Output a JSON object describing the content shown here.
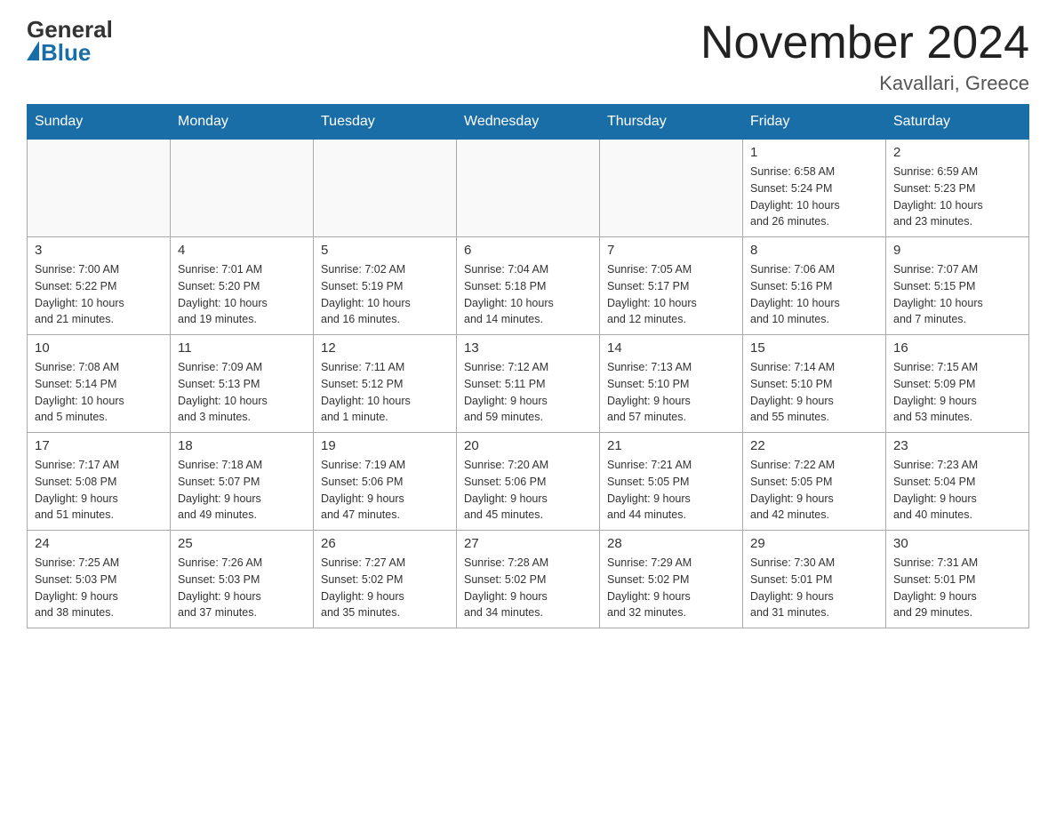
{
  "header": {
    "logo_general": "General",
    "logo_blue": "Blue",
    "month_title": "November 2024",
    "location": "Kavallari, Greece"
  },
  "weekdays": [
    "Sunday",
    "Monday",
    "Tuesday",
    "Wednesday",
    "Thursday",
    "Friday",
    "Saturday"
  ],
  "weeks": [
    [
      {
        "day": "",
        "info": ""
      },
      {
        "day": "",
        "info": ""
      },
      {
        "day": "",
        "info": ""
      },
      {
        "day": "",
        "info": ""
      },
      {
        "day": "",
        "info": ""
      },
      {
        "day": "1",
        "info": "Sunrise: 6:58 AM\nSunset: 5:24 PM\nDaylight: 10 hours\nand 26 minutes."
      },
      {
        "day": "2",
        "info": "Sunrise: 6:59 AM\nSunset: 5:23 PM\nDaylight: 10 hours\nand 23 minutes."
      }
    ],
    [
      {
        "day": "3",
        "info": "Sunrise: 7:00 AM\nSunset: 5:22 PM\nDaylight: 10 hours\nand 21 minutes."
      },
      {
        "day": "4",
        "info": "Sunrise: 7:01 AM\nSunset: 5:20 PM\nDaylight: 10 hours\nand 19 minutes."
      },
      {
        "day": "5",
        "info": "Sunrise: 7:02 AM\nSunset: 5:19 PM\nDaylight: 10 hours\nand 16 minutes."
      },
      {
        "day": "6",
        "info": "Sunrise: 7:04 AM\nSunset: 5:18 PM\nDaylight: 10 hours\nand 14 minutes."
      },
      {
        "day": "7",
        "info": "Sunrise: 7:05 AM\nSunset: 5:17 PM\nDaylight: 10 hours\nand 12 minutes."
      },
      {
        "day": "8",
        "info": "Sunrise: 7:06 AM\nSunset: 5:16 PM\nDaylight: 10 hours\nand 10 minutes."
      },
      {
        "day": "9",
        "info": "Sunrise: 7:07 AM\nSunset: 5:15 PM\nDaylight: 10 hours\nand 7 minutes."
      }
    ],
    [
      {
        "day": "10",
        "info": "Sunrise: 7:08 AM\nSunset: 5:14 PM\nDaylight: 10 hours\nand 5 minutes."
      },
      {
        "day": "11",
        "info": "Sunrise: 7:09 AM\nSunset: 5:13 PM\nDaylight: 10 hours\nand 3 minutes."
      },
      {
        "day": "12",
        "info": "Sunrise: 7:11 AM\nSunset: 5:12 PM\nDaylight: 10 hours\nand 1 minute."
      },
      {
        "day": "13",
        "info": "Sunrise: 7:12 AM\nSunset: 5:11 PM\nDaylight: 9 hours\nand 59 minutes."
      },
      {
        "day": "14",
        "info": "Sunrise: 7:13 AM\nSunset: 5:10 PM\nDaylight: 9 hours\nand 57 minutes."
      },
      {
        "day": "15",
        "info": "Sunrise: 7:14 AM\nSunset: 5:10 PM\nDaylight: 9 hours\nand 55 minutes."
      },
      {
        "day": "16",
        "info": "Sunrise: 7:15 AM\nSunset: 5:09 PM\nDaylight: 9 hours\nand 53 minutes."
      }
    ],
    [
      {
        "day": "17",
        "info": "Sunrise: 7:17 AM\nSunset: 5:08 PM\nDaylight: 9 hours\nand 51 minutes."
      },
      {
        "day": "18",
        "info": "Sunrise: 7:18 AM\nSunset: 5:07 PM\nDaylight: 9 hours\nand 49 minutes."
      },
      {
        "day": "19",
        "info": "Sunrise: 7:19 AM\nSunset: 5:06 PM\nDaylight: 9 hours\nand 47 minutes."
      },
      {
        "day": "20",
        "info": "Sunrise: 7:20 AM\nSunset: 5:06 PM\nDaylight: 9 hours\nand 45 minutes."
      },
      {
        "day": "21",
        "info": "Sunrise: 7:21 AM\nSunset: 5:05 PM\nDaylight: 9 hours\nand 44 minutes."
      },
      {
        "day": "22",
        "info": "Sunrise: 7:22 AM\nSunset: 5:05 PM\nDaylight: 9 hours\nand 42 minutes."
      },
      {
        "day": "23",
        "info": "Sunrise: 7:23 AM\nSunset: 5:04 PM\nDaylight: 9 hours\nand 40 minutes."
      }
    ],
    [
      {
        "day": "24",
        "info": "Sunrise: 7:25 AM\nSunset: 5:03 PM\nDaylight: 9 hours\nand 38 minutes."
      },
      {
        "day": "25",
        "info": "Sunrise: 7:26 AM\nSunset: 5:03 PM\nDaylight: 9 hours\nand 37 minutes."
      },
      {
        "day": "26",
        "info": "Sunrise: 7:27 AM\nSunset: 5:02 PM\nDaylight: 9 hours\nand 35 minutes."
      },
      {
        "day": "27",
        "info": "Sunrise: 7:28 AM\nSunset: 5:02 PM\nDaylight: 9 hours\nand 34 minutes."
      },
      {
        "day": "28",
        "info": "Sunrise: 7:29 AM\nSunset: 5:02 PM\nDaylight: 9 hours\nand 32 minutes."
      },
      {
        "day": "29",
        "info": "Sunrise: 7:30 AM\nSunset: 5:01 PM\nDaylight: 9 hours\nand 31 minutes."
      },
      {
        "day": "30",
        "info": "Sunrise: 7:31 AM\nSunset: 5:01 PM\nDaylight: 9 hours\nand 29 minutes."
      }
    ]
  ]
}
